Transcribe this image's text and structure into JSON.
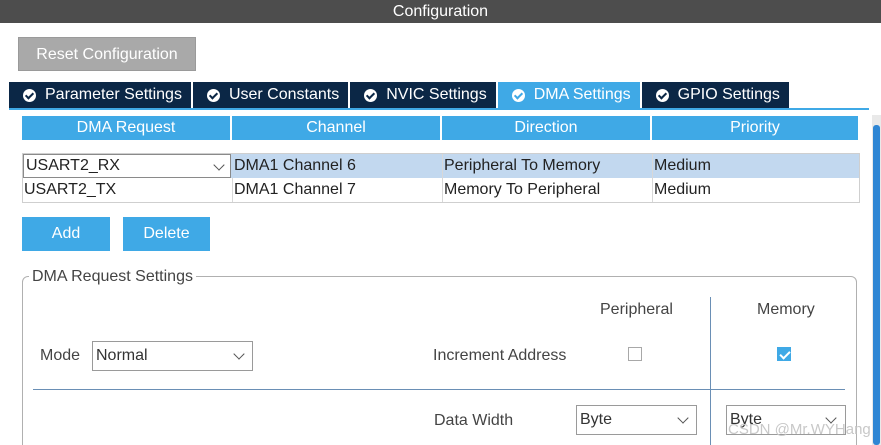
{
  "window": {
    "title": "Configuration"
  },
  "toolbar": {
    "reset_label": "Reset Configuration"
  },
  "tabs": [
    {
      "label": "Parameter Settings",
      "active": false
    },
    {
      "label": "User Constants",
      "active": false
    },
    {
      "label": "NVIC Settings",
      "active": false
    },
    {
      "label": "DMA Settings",
      "active": true
    },
    {
      "label": "GPIO Settings",
      "active": false
    }
  ],
  "dma_table": {
    "columns": [
      "DMA Request",
      "Channel",
      "Direction",
      "Priority"
    ],
    "rows": [
      {
        "request": "USART2_RX",
        "channel": "DMA1 Channel 6",
        "direction": "Peripheral To Memory",
        "priority": "Medium",
        "selected": true
      },
      {
        "request": "USART2_TX",
        "channel": "DMA1 Channel 7",
        "direction": "Memory To Peripheral",
        "priority": "Medium",
        "selected": false
      }
    ]
  },
  "actions": {
    "add_label": "Add",
    "delete_label": "Delete"
  },
  "request_settings": {
    "legend": "DMA Request Settings",
    "peripheral_header": "Peripheral",
    "memory_header": "Memory",
    "mode_label": "Mode",
    "mode_value": "Normal",
    "increment_label": "Increment Address",
    "increment_peripheral": false,
    "increment_memory": true,
    "data_width_label": "Data Width",
    "data_width_peripheral": "Byte",
    "data_width_memory": "Byte"
  },
  "watermark": "CSDN @Mr.WYHang",
  "colors": {
    "accent": "#3fa9e6",
    "tab_bg": "#0b2746",
    "title_bar": "#4d4d4d",
    "selected_row": "#c2d8ef"
  }
}
